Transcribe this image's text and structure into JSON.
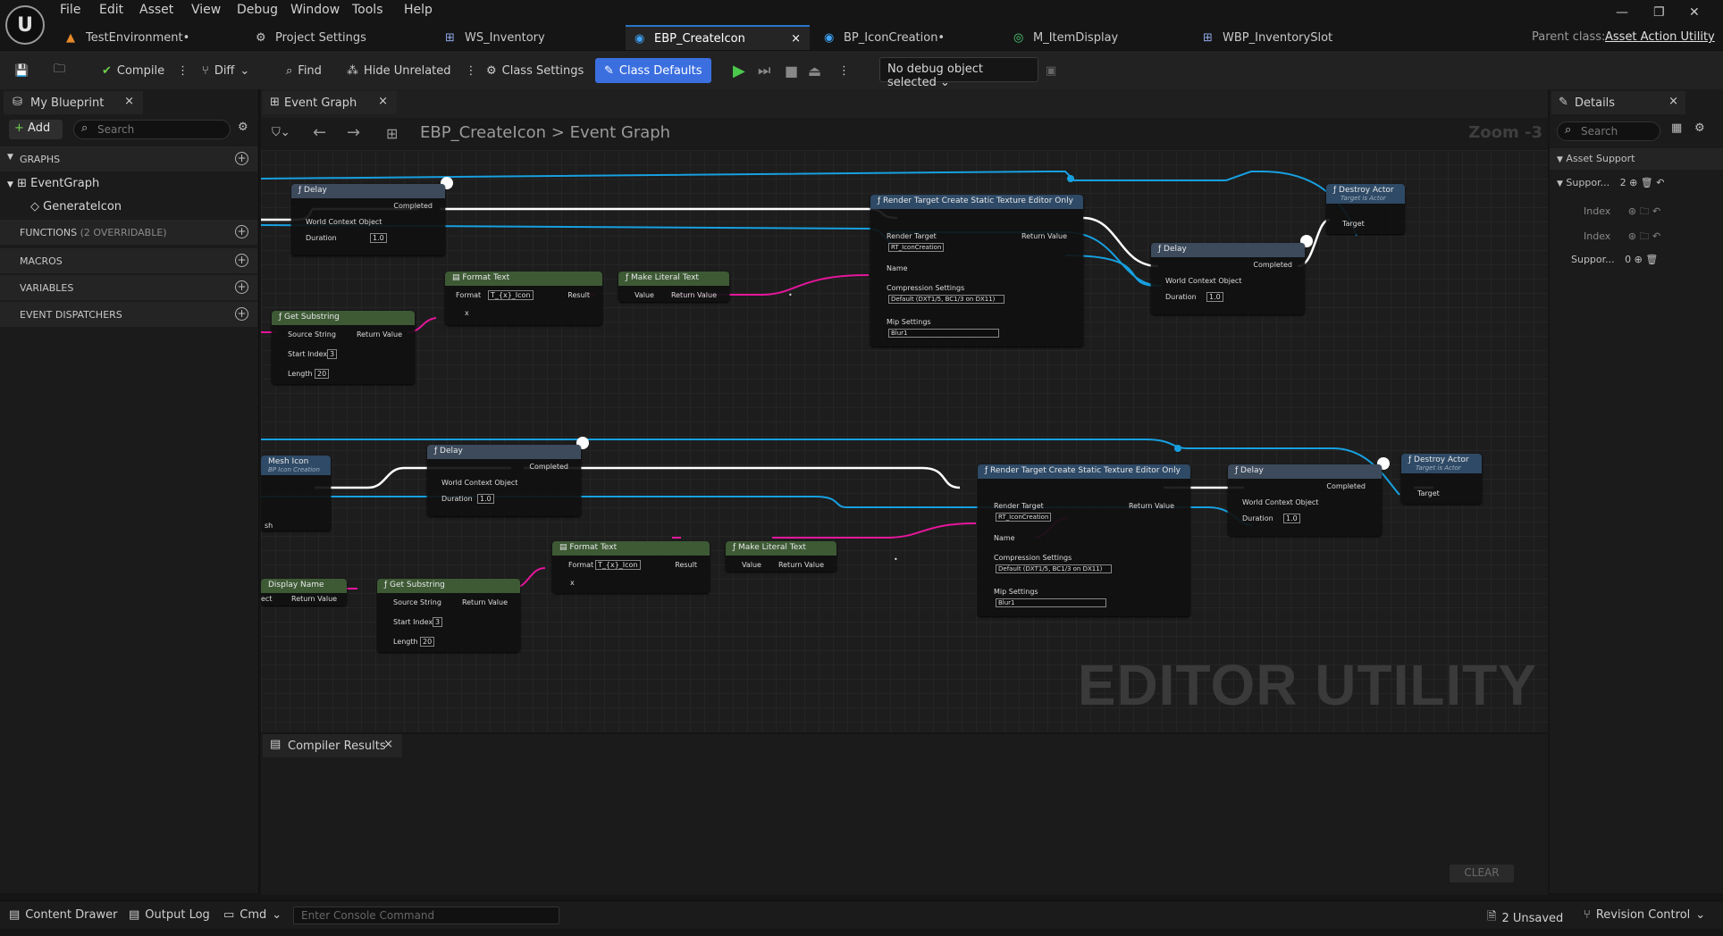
{
  "menu": [
    "File",
    "Edit",
    "Asset",
    "View",
    "Debug",
    "Window",
    "Tools",
    "Help"
  ],
  "doc_tabs": [
    {
      "label": "TestEnvironment•"
    },
    {
      "label": "Project Settings"
    },
    {
      "label": "WS_Inventory"
    },
    {
      "label": "EBP_CreateIcon"
    },
    {
      "label": "BP_IconCreation•"
    },
    {
      "label": "M_ItemDisplay"
    },
    {
      "label": "WBP_InventorySlot"
    }
  ],
  "parent_class": {
    "label": "Parent class:",
    "value": "Asset Action Utility"
  },
  "toolbar": {
    "compile": "Compile",
    "diff": "Diff",
    "find": "Find",
    "hide_unrelated": "Hide Unrelated",
    "class_settings": "Class Settings",
    "class_defaults": "Class Defaults",
    "debug_selector": "No debug object selected"
  },
  "my_blueprint": {
    "tab": "My Blueprint",
    "add": "Add",
    "search_placeholder": "Search",
    "graphs_header": "GRAPHS",
    "graph_item": "EventGraph",
    "graph_sub": "GenerateIcon",
    "functions": "FUNCTIONS",
    "functions_note": "(2 OVERRIDABLE)",
    "macros": "MACROS",
    "variables": "VARIABLES",
    "dispatchers": "EVENT DISPATCHERS"
  },
  "graph": {
    "tab": "Event Graph",
    "breadcrumb_root": "EBP_CreateIcon",
    "breadcrumb_sep": ">",
    "breadcrumb_leaf": "Event Graph",
    "zoom": "Zoom -3",
    "watermark": "EDITOR UTILITY",
    "nodes": {
      "delay": "Delay",
      "completed": "Completed",
      "world_context": "World Context Object",
      "duration": "Duration",
      "duration_val": "1.0",
      "format_text": "Format Text",
      "format": "Format",
      "format_val": "T_{x}_Icon",
      "result": "Result",
      "x": "x",
      "make_literal": "Make Literal Text",
      "value": "Value",
      "return_value": "Return Value",
      "render_target_node": "Render Target Create Static Texture Editor Only",
      "render_target": "Render Target",
      "rt_val": "RT_IconCreation",
      "name": "Name",
      "compression": "Compression Settings",
      "compression_val": "Default (DXT1/5, BC1/3 on DX11)",
      "mip": "Mip Settings",
      "mip_val": "Blur1",
      "destroy_actor": "Destroy Actor",
      "target_is_actor": "Target is Actor",
      "target": "Target",
      "get_substring": "Get Substring",
      "source_string": "Source String",
      "start_index": "Start Index",
      "start_index_val": "3",
      "length": "Length",
      "length_val": "20",
      "mesh_icon": "Mesh Icon",
      "mesh_icon_sub": "BP Icon Creation",
      "mesh_pin": "sh",
      "display_name": "Display Name",
      "display_name_pin": "ect",
      "reroute_val": "•"
    }
  },
  "compiler": {
    "tab": "Compiler Results",
    "clear": "CLEAR"
  },
  "details": {
    "tab": "Details",
    "search_placeholder": "Search",
    "section": "Asset Support",
    "row1_label": "Suppor...",
    "row1_count": "2",
    "index_label": "Index",
    "row2_label": "Suppor...",
    "row2_count": "0"
  },
  "status": {
    "content_drawer": "Content Drawer",
    "output_log": "Output Log",
    "cmd": "Cmd",
    "console_placeholder": "Enter Console Command",
    "unsaved": "2 Unsaved",
    "revision": "Revision Control"
  },
  "colors": {
    "exec": "#ffffff",
    "object": "#17a0e0",
    "string": "#e5169c",
    "float": "#33c46a",
    "accent": "#3b6fe0"
  }
}
